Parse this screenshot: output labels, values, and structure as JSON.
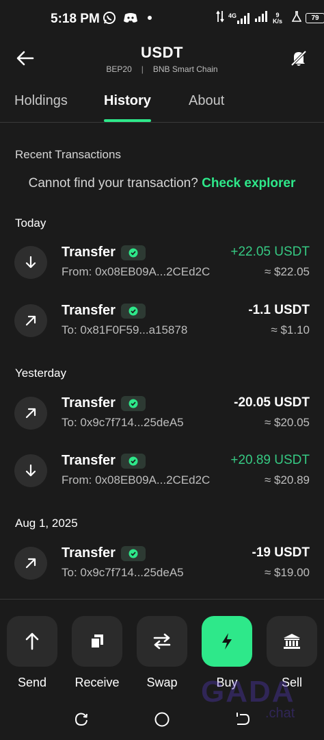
{
  "status_bar": {
    "time": "5:18 PM",
    "icons": [
      "whatsapp-icon",
      "discord-icon",
      "dot-icon",
      "data-arrows-icon",
      "signal-4g-icon",
      "signal-icon",
      "flask-icon"
    ],
    "network": "4G",
    "speed_value": "9",
    "speed_unit": "K/s",
    "battery": "79"
  },
  "header": {
    "title": "USDT",
    "network_tag": "BEP20",
    "separator": "|",
    "chain": "BNB Smart Chain"
  },
  "tabs": [
    {
      "label": "Holdings",
      "active": false
    },
    {
      "label": "History",
      "active": true
    },
    {
      "label": "About",
      "active": false
    }
  ],
  "history": {
    "section_title": "Recent Transactions",
    "explorer_prompt": "Cannot find your transaction?",
    "explorer_link": "Check explorer",
    "groups": [
      {
        "label": "Today",
        "transactions": [
          {
            "type": "Transfer",
            "direction": "in",
            "address": "From: 0x08EB09A...2CEd2C",
            "amount": "+22.05 USDT",
            "usd": "≈ $22.05"
          },
          {
            "type": "Transfer",
            "direction": "out",
            "address": "To: 0x81F0F59...a15878",
            "amount": "-1.1 USDT",
            "usd": "≈ $1.10"
          }
        ]
      },
      {
        "label": "Yesterday",
        "transactions": [
          {
            "type": "Transfer",
            "direction": "out",
            "address": "To: 0x9c7f714...25deA5",
            "amount": "-20.05 USDT",
            "usd": "≈ $20.05"
          },
          {
            "type": "Transfer",
            "direction": "in",
            "address": "From: 0x08EB09A...2CEd2C",
            "amount": "+20.89 USDT",
            "usd": "≈ $20.89"
          }
        ]
      },
      {
        "label": "Aug 1, 2025",
        "transactions": [
          {
            "type": "Transfer",
            "direction": "out",
            "address": "To: 0x9c7f714...25deA5",
            "amount": "-19 USDT",
            "usd": "≈ $19.00"
          }
        ]
      }
    ]
  },
  "actions": [
    {
      "label": "Send",
      "icon": "arrow-up-icon"
    },
    {
      "label": "Receive",
      "icon": "copy-icon"
    },
    {
      "label": "Swap",
      "icon": "swap-icon"
    },
    {
      "label": "Buy",
      "icon": "lightning-icon",
      "primary": true
    },
    {
      "label": "Sell",
      "icon": "bank-icon"
    }
  ],
  "watermark": {
    "main": "GADA",
    "sub": ".chat"
  },
  "colors": {
    "accent": "#2ee88a",
    "positive": "#36c983",
    "background": "#1b1b1b",
    "surface": "#2e2e2e"
  }
}
